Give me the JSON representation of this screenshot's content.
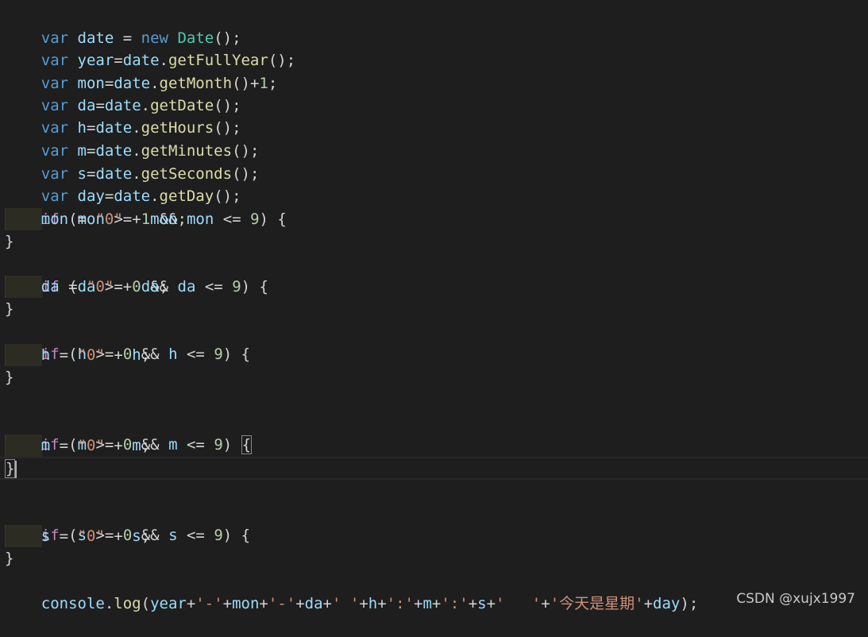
{
  "editor": {
    "lines": [
      {
        "text": "var date = new Date();"
      },
      {
        "text": "var year=date.getFullYear();"
      },
      {
        "text": "var mon=date.getMonth()+1;"
      },
      {
        "text": "var da=date.getDate();"
      },
      {
        "text": "var h=date.getHours();"
      },
      {
        "text": "var m=date.getMinutes();"
      },
      {
        "text": "var s=date.getSeconds();"
      },
      {
        "text": "var day=date.getDay();"
      },
      {
        "text": "if (mon >= 1 && mon <= 9) {"
      },
      {
        "text": "    mon = \"0\" + mon;"
      },
      {
        "text": "}"
      },
      {
        "text": "if (da >= 0 && da <= 9) {"
      },
      {
        "text": "    da = \"0\" + da;"
      },
      {
        "text": "}"
      },
      {
        "text": "if (h >= 0 && h <= 9) {"
      },
      {
        "text": "    h = \"0\" + h;"
      },
      {
        "text": "}"
      },
      {
        "text": ""
      },
      {
        "text": "if (m >= 0 && m <= 9) {"
      },
      {
        "text": "    m = \"0\" + m;"
      },
      {
        "text": "}"
      },
      {
        "text": ""
      },
      {
        "text": "if (s >= 0 && s <= 9) {"
      },
      {
        "text": "    s = \"0\" + s;"
      },
      {
        "text": "}"
      },
      {
        "text": "console.log(year+'-'+mon+'-'+da+' '+h+':'+m+':'+s+'   '+'今天是星期'+day);"
      }
    ]
  },
  "watermark": "CSDN @xujx1997",
  "colors": {
    "background": "#1e1e1e",
    "keyword": "#569cd6",
    "control": "#c586c0",
    "identifier": "#9cdcfe",
    "function": "#dcdcaa",
    "number": "#b5cea8",
    "string": "#ce9178",
    "class": "#4ec9b0"
  }
}
